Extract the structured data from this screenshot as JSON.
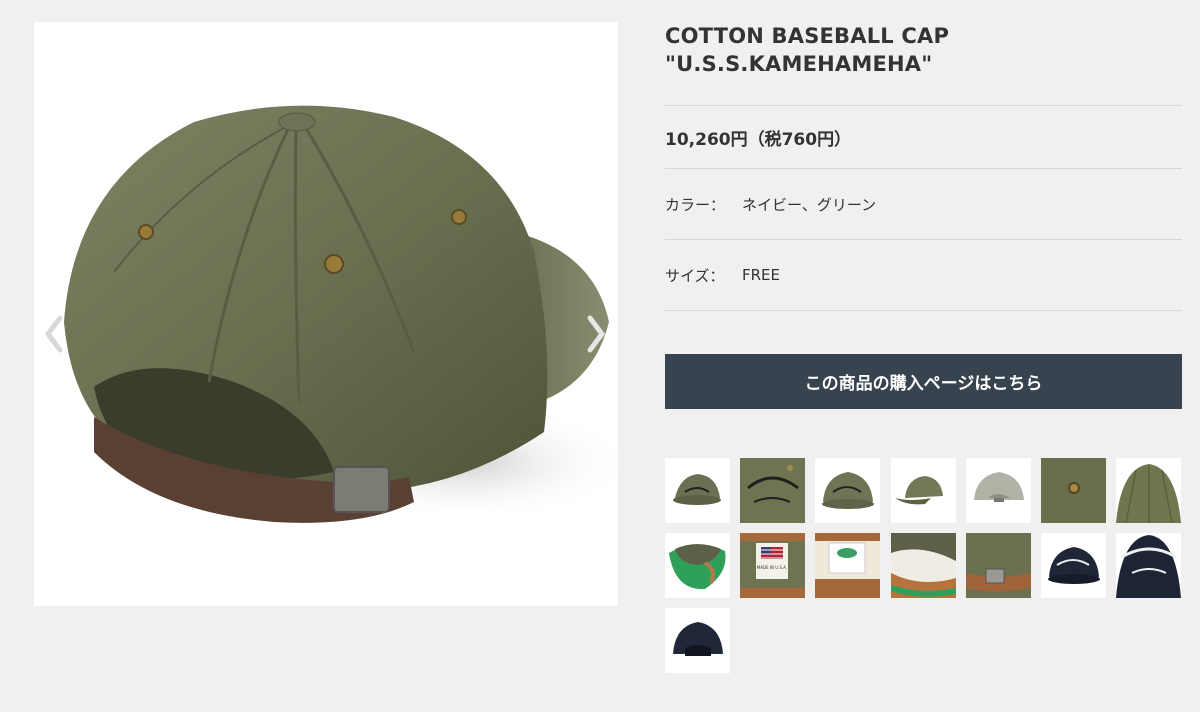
{
  "product": {
    "title_line1": "COTTON BASEBALL CAP",
    "title_line2": "\"U.S.S.KAMEHAMEHA\"",
    "price": "10,260円（税760円）",
    "color_label": "カラー：",
    "color_value": "ネイビー、グリーン",
    "size_label": "サイズ：",
    "size_value": "FREE",
    "buy_button": "この商品の購入ページはこちら"
  },
  "gallery": {
    "prev_icon": "chevron-left-icon",
    "next_icon": "chevron-right-icon",
    "thumb_labels": {
      "flag_text": "MADE IN U.S.A.",
      "embroidery": "U.S.S. KAMEHAMEHA"
    },
    "thumbnails": [
      {
        "name": "green-cap-front"
      },
      {
        "name": "green-cap-embroidery"
      },
      {
        "name": "green-cap-side"
      },
      {
        "name": "green-cap-profile"
      },
      {
        "name": "grey-cap-back"
      },
      {
        "name": "green-fabric-eyelet"
      },
      {
        "name": "green-cap-crown"
      },
      {
        "name": "cap-underside-green"
      },
      {
        "name": "made-in-usa-tag"
      },
      {
        "name": "cap-inner-label"
      },
      {
        "name": "cap-sweatband"
      },
      {
        "name": "leather-strap-detail"
      },
      {
        "name": "navy-cap-front"
      },
      {
        "name": "navy-cap-embroidery"
      },
      {
        "name": "navy-cap-back"
      }
    ]
  },
  "colors": {
    "background": "#f0f0f0",
    "button": "#37444f",
    "cap_olive": "#6b7052",
    "cap_navy": "#1f2638"
  }
}
